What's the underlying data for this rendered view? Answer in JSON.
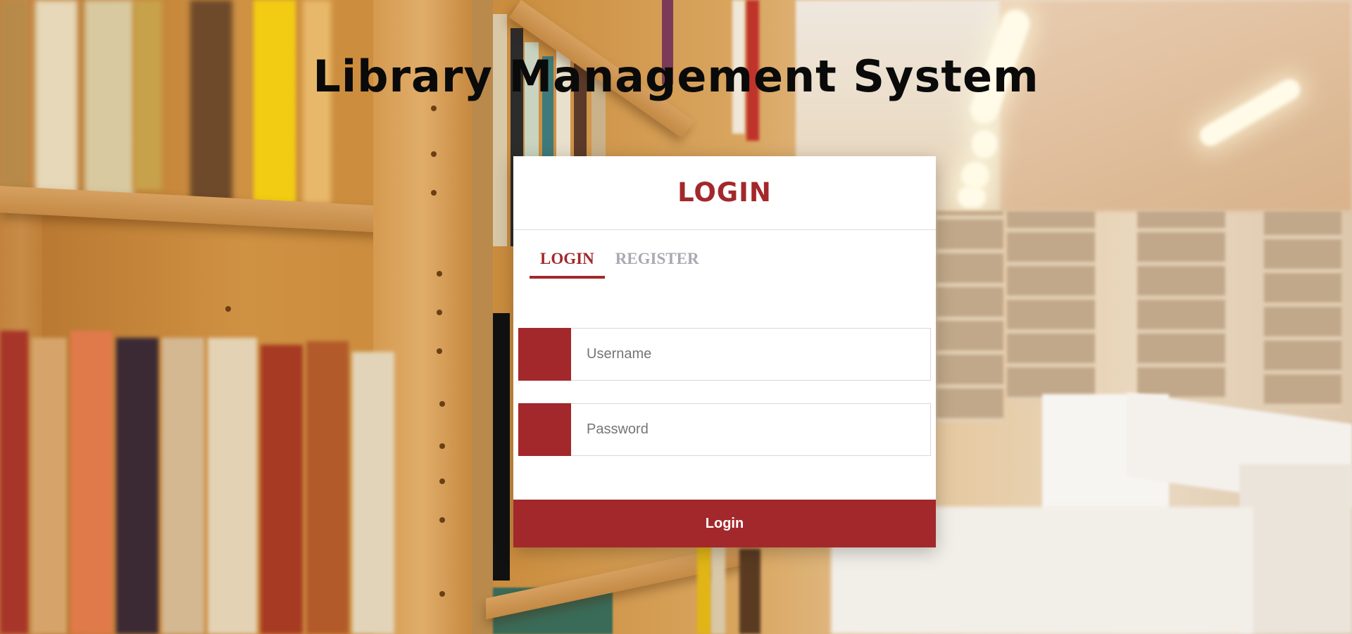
{
  "page": {
    "title": "Library Management System"
  },
  "login_card": {
    "header": "LOGIN",
    "tabs": [
      {
        "label": "LOGIN",
        "active": true
      },
      {
        "label": "REGISTER",
        "active": false
      }
    ],
    "username": {
      "placeholder": "Username",
      "value": ""
    },
    "password": {
      "placeholder": "Password",
      "value": ""
    },
    "submit_label": "Login"
  },
  "colors": {
    "accent": "#a3282b",
    "inactive_tab": "#a9a9b1",
    "title": "#0a0a0a",
    "card_bg": "#ffffff"
  },
  "icons": {
    "username": "user-icon",
    "password": "lock-icon"
  }
}
